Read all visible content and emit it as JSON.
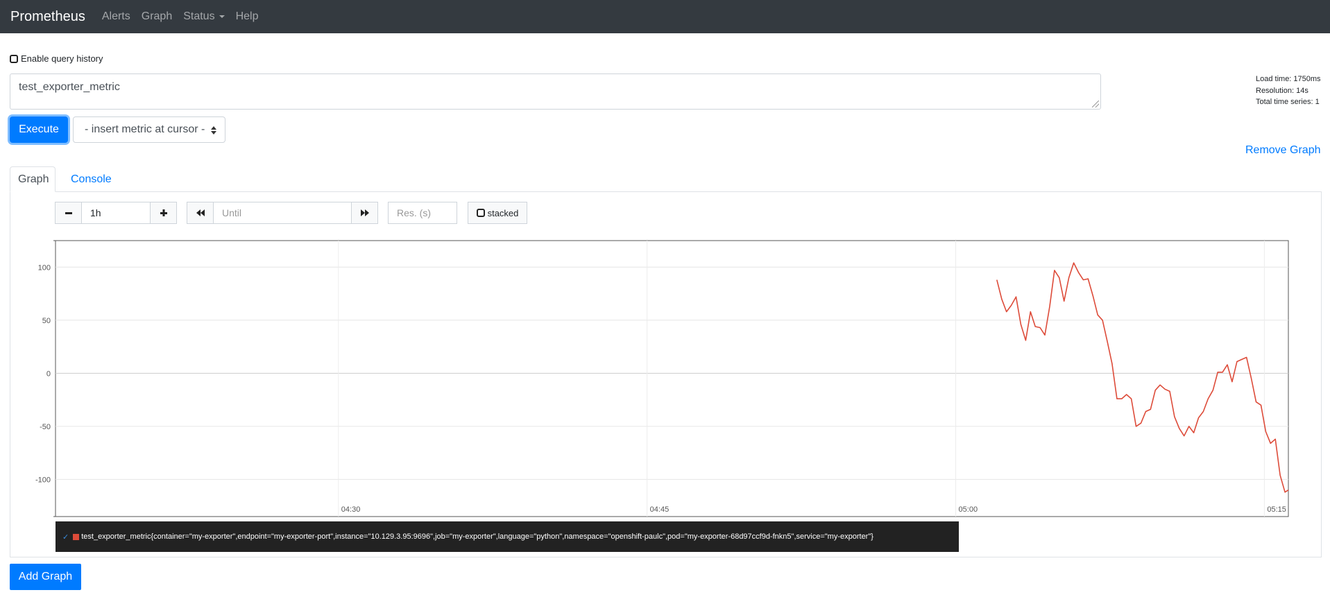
{
  "navbar": {
    "brand": "Prometheus",
    "items": [
      {
        "label": "Alerts"
      },
      {
        "label": "Graph"
      },
      {
        "label": "Status"
      },
      {
        "label": "Help"
      }
    ]
  },
  "query_history": {
    "label": "Enable query history",
    "checked": false
  },
  "query": {
    "value": "test_exporter_metric"
  },
  "stats": {
    "load_time": "Load time: 1750ms",
    "resolution": "Resolution: 14s",
    "total_series": "Total time series: 1"
  },
  "execute_label": "Execute",
  "metric_select": {
    "selected": "- insert metric at cursor -"
  },
  "remove_graph_label": "Remove Graph",
  "tabs": [
    {
      "label": "Graph",
      "active": true
    },
    {
      "label": "Console",
      "active": false
    }
  ],
  "controls": {
    "range": "1h",
    "until_placeholder": "Until",
    "res_placeholder": "Res. (s)",
    "stacked_label": "stacked"
  },
  "colors": {
    "series": "#dd4b39",
    "accent": "#007bff",
    "navbar": "#343a40"
  },
  "chart_data": {
    "type": "line",
    "title": "",
    "xlabel": "",
    "ylabel": "",
    "x_ticks": [
      "04:30",
      "04:45",
      "05:00",
      "05:15"
    ],
    "y_ticks": [
      100,
      50,
      0,
      -50,
      -100
    ],
    "xlim": [
      "04:16:15",
      "05:16:10"
    ],
    "ylim": [
      -135,
      125
    ],
    "grid": true,
    "series": [
      {
        "name": "test_exporter_metric{container=\"my-exporter\",endpoint=\"my-exporter-port\",instance=\"10.129.3.95:9696\",job=\"my-exporter\",language=\"python\",namespace=\"openshift-paulc\",pod=\"my-exporter-68d97ccf9d-fnkn5\",service=\"my-exporter\"}",
        "color": "#dd4b39",
        "points": [
          [
            "05:02:00",
            88
          ],
          [
            "05:02:14",
            70
          ],
          [
            "05:02:28",
            58
          ],
          [
            "05:02:42",
            64
          ],
          [
            "05:02:56",
            72
          ],
          [
            "05:03:10",
            46
          ],
          [
            "05:03:24",
            31
          ],
          [
            "05:03:38",
            58
          ],
          [
            "05:03:52",
            44
          ],
          [
            "05:04:06",
            43
          ],
          [
            "05:04:20",
            36
          ],
          [
            "05:04:34",
            63
          ],
          [
            "05:04:48",
            97
          ],
          [
            "05:05:02",
            90
          ],
          [
            "05:05:16",
            68
          ],
          [
            "05:05:30",
            90
          ],
          [
            "05:05:44",
            104
          ],
          [
            "05:05:58",
            95
          ],
          [
            "05:06:12",
            88
          ],
          [
            "05:06:26",
            89
          ],
          [
            "05:06:40",
            73
          ],
          [
            "05:06:54",
            55
          ],
          [
            "05:07:08",
            50
          ],
          [
            "05:07:22",
            30
          ],
          [
            "05:07:36",
            9
          ],
          [
            "05:07:50",
            -24
          ],
          [
            "05:08:04",
            -24
          ],
          [
            "05:08:18",
            -20
          ],
          [
            "05:08:32",
            -24
          ],
          [
            "05:08:46",
            -50
          ],
          [
            "05:09:00",
            -47
          ],
          [
            "05:09:14",
            -36
          ],
          [
            "05:09:28",
            -34
          ],
          [
            "05:09:42",
            -16
          ],
          [
            "05:09:56",
            -11
          ],
          [
            "05:10:10",
            -15
          ],
          [
            "05:10:24",
            -17
          ],
          [
            "05:10:38",
            -41
          ],
          [
            "05:10:52",
            -52
          ],
          [
            "05:11:06",
            -59
          ],
          [
            "05:11:20",
            -50
          ],
          [
            "05:11:34",
            -56
          ],
          [
            "05:11:48",
            -42
          ],
          [
            "05:12:02",
            -36
          ],
          [
            "05:12:16",
            -24
          ],
          [
            "05:12:30",
            -16
          ],
          [
            "05:12:44",
            1
          ],
          [
            "05:12:58",
            1
          ],
          [
            "05:13:12",
            8
          ],
          [
            "05:13:26",
            -8
          ],
          [
            "05:13:40",
            11
          ],
          [
            "05:13:54",
            13
          ],
          [
            "05:14:08",
            15
          ],
          [
            "05:14:22",
            -5
          ],
          [
            "05:14:36",
            -27
          ],
          [
            "05:14:50",
            -30
          ],
          [
            "05:15:04",
            -55
          ],
          [
            "05:15:18",
            -66
          ],
          [
            "05:15:32",
            -62
          ],
          [
            "05:15:46",
            -96
          ],
          [
            "05:16:00",
            -112
          ],
          [
            "05:16:10",
            -110
          ]
        ]
      }
    ]
  }
}
